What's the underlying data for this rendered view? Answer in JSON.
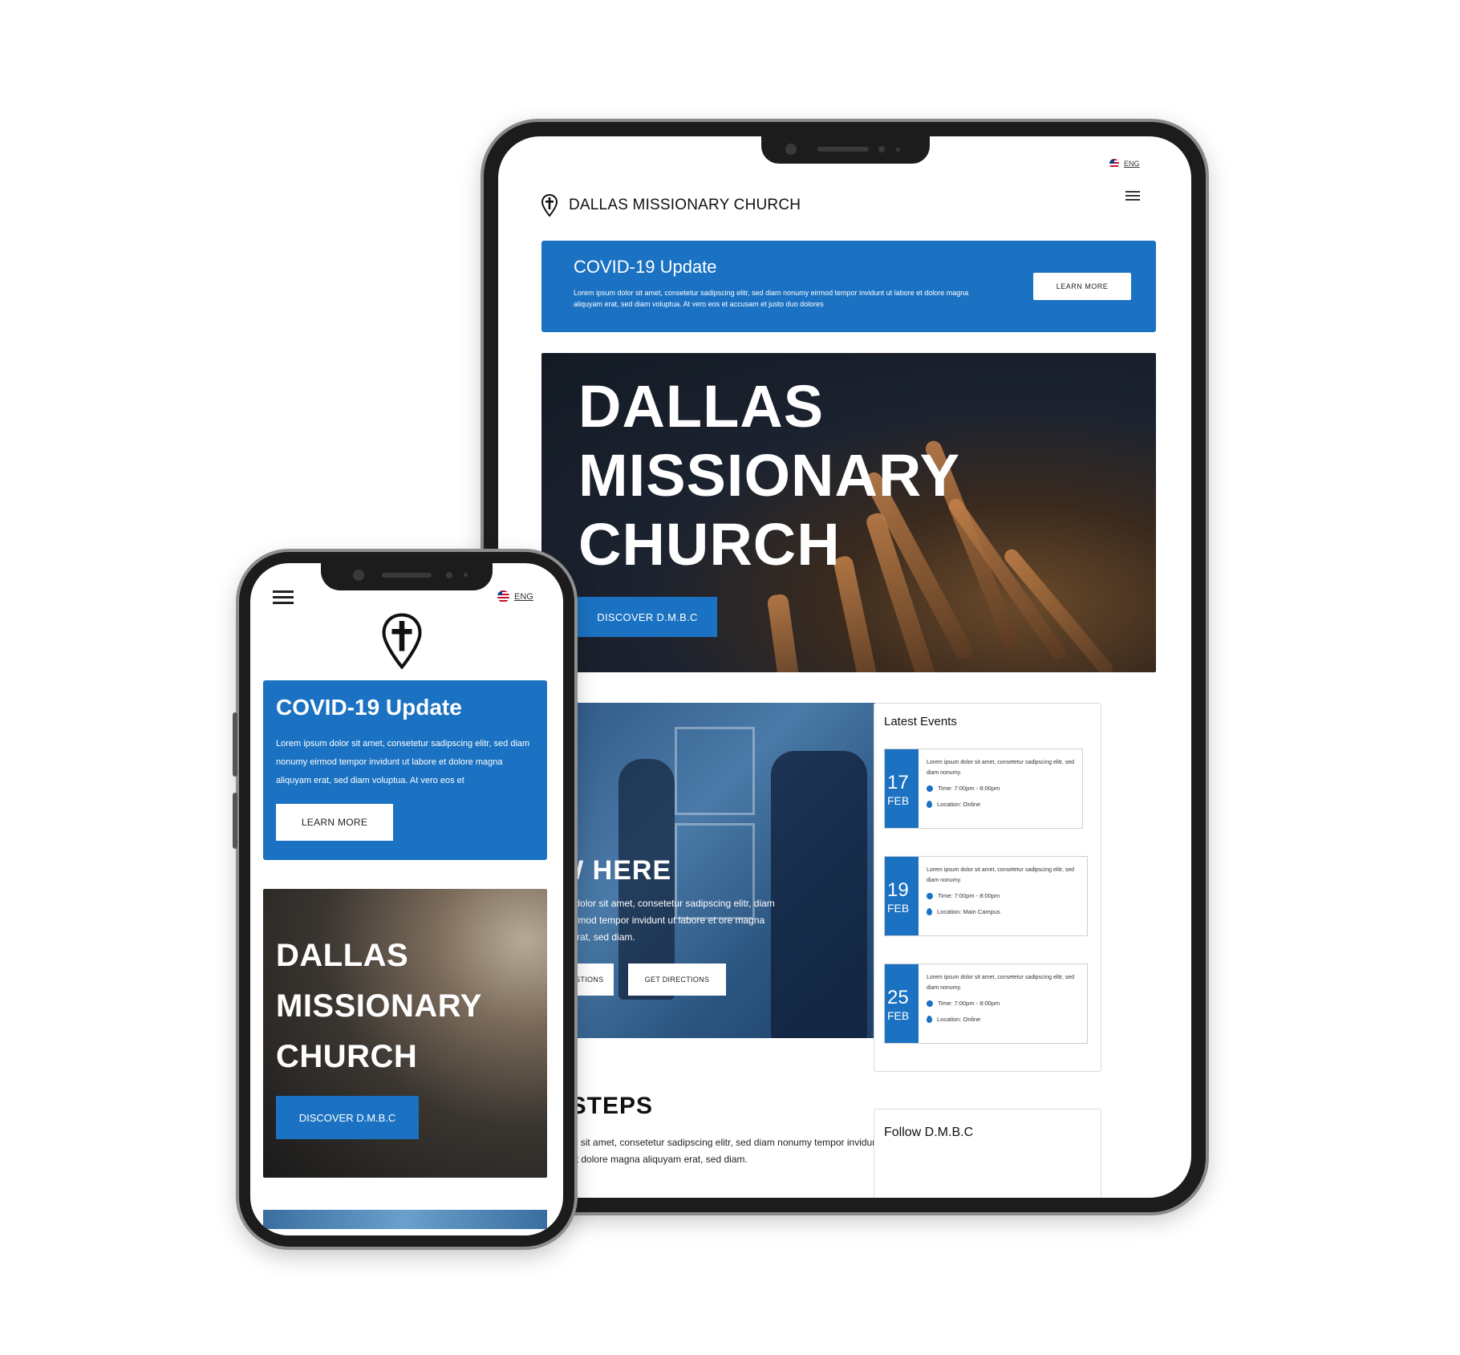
{
  "colors": {
    "brand_blue": "#1b72c2",
    "dark_hero": "#121a24",
    "white": "#ffffff"
  },
  "tablet": {
    "lang": "ENG",
    "brand": "DALLAS MISSIONARY CHURCH",
    "menu_icon": "hamburger-icon",
    "covid": {
      "title": "COVID-19 Update",
      "body": "Lorem ipsum dolor sit amet, consetetur sadipscing elitr, sed diam nonumy eirmod tempor invidunt ut labore et dolore magna aliquyam erat, sed diam voluptua. At vero eos et accusam et justo duo dolores",
      "button": "LEARN MORE"
    },
    "hero": {
      "title_line1": "DALLAS",
      "title_line2": "MISSIONARY",
      "title_line3": "CHURCH",
      "button": "DISCOVER D.M.B.C"
    },
    "new_here": {
      "title": "IEW HERE",
      "body": "em ipsum dolor sit amet, consetetur sadipscing elitr, diam nonumy eirmod tempor invidunt ut labore et ore magna aliquyam erat, sed diam.",
      "button_questions": "GOT QUESTIONS",
      "button_directions": "GET DIRECTIONS"
    },
    "events": {
      "title": "Latest Events",
      "items": [
        {
          "day": "17",
          "month": "FEB",
          "desc": "Lorem ipsum dolor sit amet, consetetur sadipscing elitr, sed diam nonumy.",
          "time": "Time: 7:00pm - 8:00pm",
          "location": "Location: Online"
        },
        {
          "day": "19",
          "month": "FEB",
          "desc": "Lorem ipsum dolor sit amet, consetetur sadipscing elitr, sed diam nonumy.",
          "time": "Time: 7:00pm - 8:00pm",
          "location": "Location: Main Campus"
        },
        {
          "day": "25",
          "month": "FEB",
          "desc": "Lorem ipsum dolor sit amet, consetetur sadipscing elitr, sed diam nonumy.",
          "time": "Time: 7:00pm - 8:00pm",
          "location": "Location: Online"
        }
      ]
    },
    "next_steps": {
      "title": "XT STEPS",
      "body": "psum dolor sit amet, consetetur sadipscing elitr, sed diam nonumy tempor invidunt ut labore et dolore magna aliquyam erat, sed diam."
    },
    "follow": {
      "title": "Follow D.M.B.C"
    }
  },
  "phone": {
    "lang": "ENG",
    "menu_icon": "hamburger-icon",
    "logo_icon": "cross-pin-icon",
    "covid": {
      "title": "COVID-19 Update",
      "body": "Lorem ipsum dolor sit amet, consetetur sadipscing elitr, sed diam nonumy eirmod tempor invidunt ut labore et dolore magna aliquyam erat, sed diam voluptua. At vero eos et",
      "button": "LEARN MORE"
    },
    "hero": {
      "title_line1": "DALLAS",
      "title_line2": "MISSIONARY",
      "title_line3": "CHURCH",
      "button": "DISCOVER D.M.B.C"
    }
  }
}
